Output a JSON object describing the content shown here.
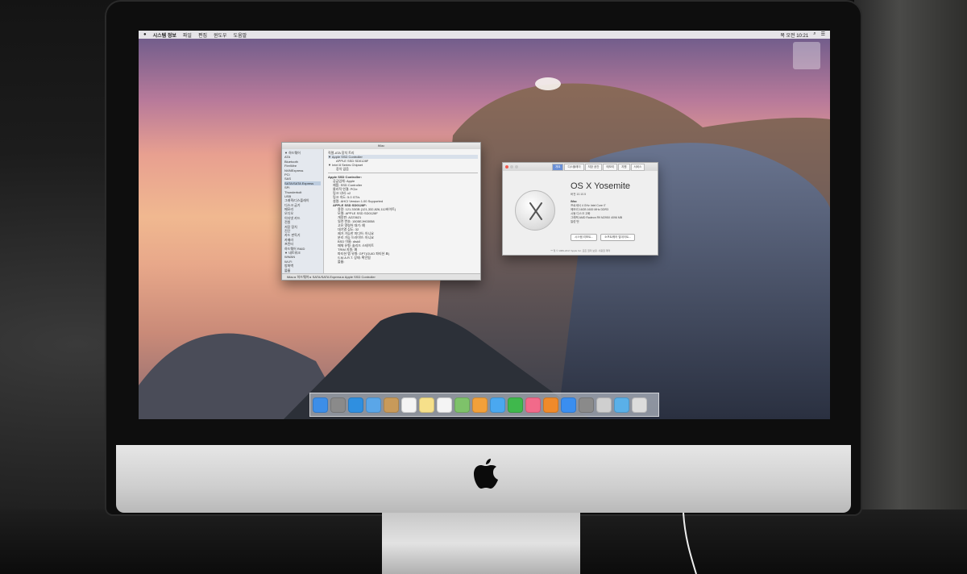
{
  "menubar": {
    "app_menu": "시스템 정보",
    "items": [
      "파일",
      "편집",
      "윈도우",
      "도움말"
    ],
    "clock": "목 오전 10:21"
  },
  "sysinfo": {
    "title": "iMac",
    "sidebar_items": [
      "▼ 하드웨어",
      "ATA",
      "Bluetooth",
      "FireWire",
      "NVMExpress",
      "PCI",
      "SAS",
      "SATA/SATA Express",
      "SPI",
      "Thunderbolt",
      "USB",
      "그래픽/디스플레이",
      "디스크 굽기",
      "메모리",
      "오디오",
      "이더넷 카드",
      "전원",
      "저장 장치",
      "진단",
      "카드 판독기",
      "카메라",
      "프린터",
      "하드웨어 RAID",
      "▼ 네트워크",
      "WWAN",
      "Wi-Fi",
      "방화벽",
      "볼륨"
    ],
    "selected_item": "SATA/SATA Express",
    "content_header": "직렬-ATA 장치 트리",
    "tree": [
      "▼ Apple SSD Controller",
      "APPLE SSD SD0128F",
      "▼ Intel 8 Series Chipset",
      "장치 없음"
    ],
    "controller_title": "Apple SSD Controller:",
    "controller_rows": [
      "공급업체:  Apple",
      "제품:  SSD Controller",
      "물리적 연결:  PCIe",
      "링크 너비:  x2",
      "링크 속도:  5.0 GT/s",
      "설명:  AHCI Version 1.00 Supported"
    ],
    "device_title": "APPLE SSD SD0128F:",
    "device_rows": [
      "용량:  121.33GB (121,332,826,112바이트)",
      "모델:  APPLE SSD SD0128F",
      "개정판:  A223621",
      "일련 번호:  1505EJH03058",
      "고유 명령어 대기:  예",
      "대기열 심도:  32",
      "제거 가능한 미디어:  아니요",
      "분리 가능 드라이브:  아니요",
      "BSD 이름:  disk0",
      "매체 유형:  솔리드 스테이트",
      "TRIM 지원:  예",
      "파티션 맵 유형:  GPT(GUID 파티션 표)",
      "S.M.A.R.T. 상태:  확인됨",
      "볼륨:"
    ],
    "status_path": "iMac ▸ 하드웨어 ▸ SATA/SATA Express ▸ Apple SSD Controller"
  },
  "about": {
    "tabs": [
      "개요",
      "디스플레이",
      "저장 공간",
      "메모리",
      "지원",
      "서비스"
    ],
    "os_name": "OS X Yosemite",
    "version": "버전 10.10.5",
    "model": "iMac",
    "specs": [
      "프로세서  4 GHz Intel Core i7",
      "메모리  16GB 1600 MHz DDR3",
      "시동 디스크  고화",
      "그래픽  AMD Radeon R9 M295X 4096 MB",
      "일련 번"
    ],
    "buttons": [
      "시스템 리포트...",
      "소프트웨어 업데이트..."
    ],
    "footer": "™ 및 © 1983-2017 Apple Inc. 모든 권리 보유. 사용권 계약"
  },
  "dock": {
    "icons": [
      {
        "name": "finder-icon",
        "color": "#3d8ee8"
      },
      {
        "name": "launchpad-icon",
        "color": "#8a8a8a"
      },
      {
        "name": "safari-icon",
        "color": "#2f8fe0"
      },
      {
        "name": "mail-icon",
        "color": "#5aa6e8"
      },
      {
        "name": "contacts-icon",
        "color": "#c89a5a"
      },
      {
        "name": "calendar-icon",
        "color": "#f4f4f4"
      },
      {
        "name": "notes-icon",
        "color": "#f6e08a"
      },
      {
        "name": "reminders-icon",
        "color": "#f4f4f4"
      },
      {
        "name": "maps-icon",
        "color": "#7ec26a"
      },
      {
        "name": "photos-icon",
        "color": "#f2a03a"
      },
      {
        "name": "messages-icon",
        "color": "#4aa8f0"
      },
      {
        "name": "facetime-icon",
        "color": "#3fb84c"
      },
      {
        "name": "itunes-icon",
        "color": "#f26a8a"
      },
      {
        "name": "ibooks-icon",
        "color": "#f08a2a"
      },
      {
        "name": "app-store-icon",
        "color": "#3a8ef0"
      },
      {
        "name": "system-preferences-icon",
        "color": "#8a8a8a"
      },
      {
        "name": "usb-drive-icon",
        "color": "#cfcfcf"
      },
      {
        "name": "downloads-folder-icon",
        "color": "#5ab0e8"
      },
      {
        "name": "trash-icon",
        "color": "#dcdcdc"
      }
    ]
  }
}
